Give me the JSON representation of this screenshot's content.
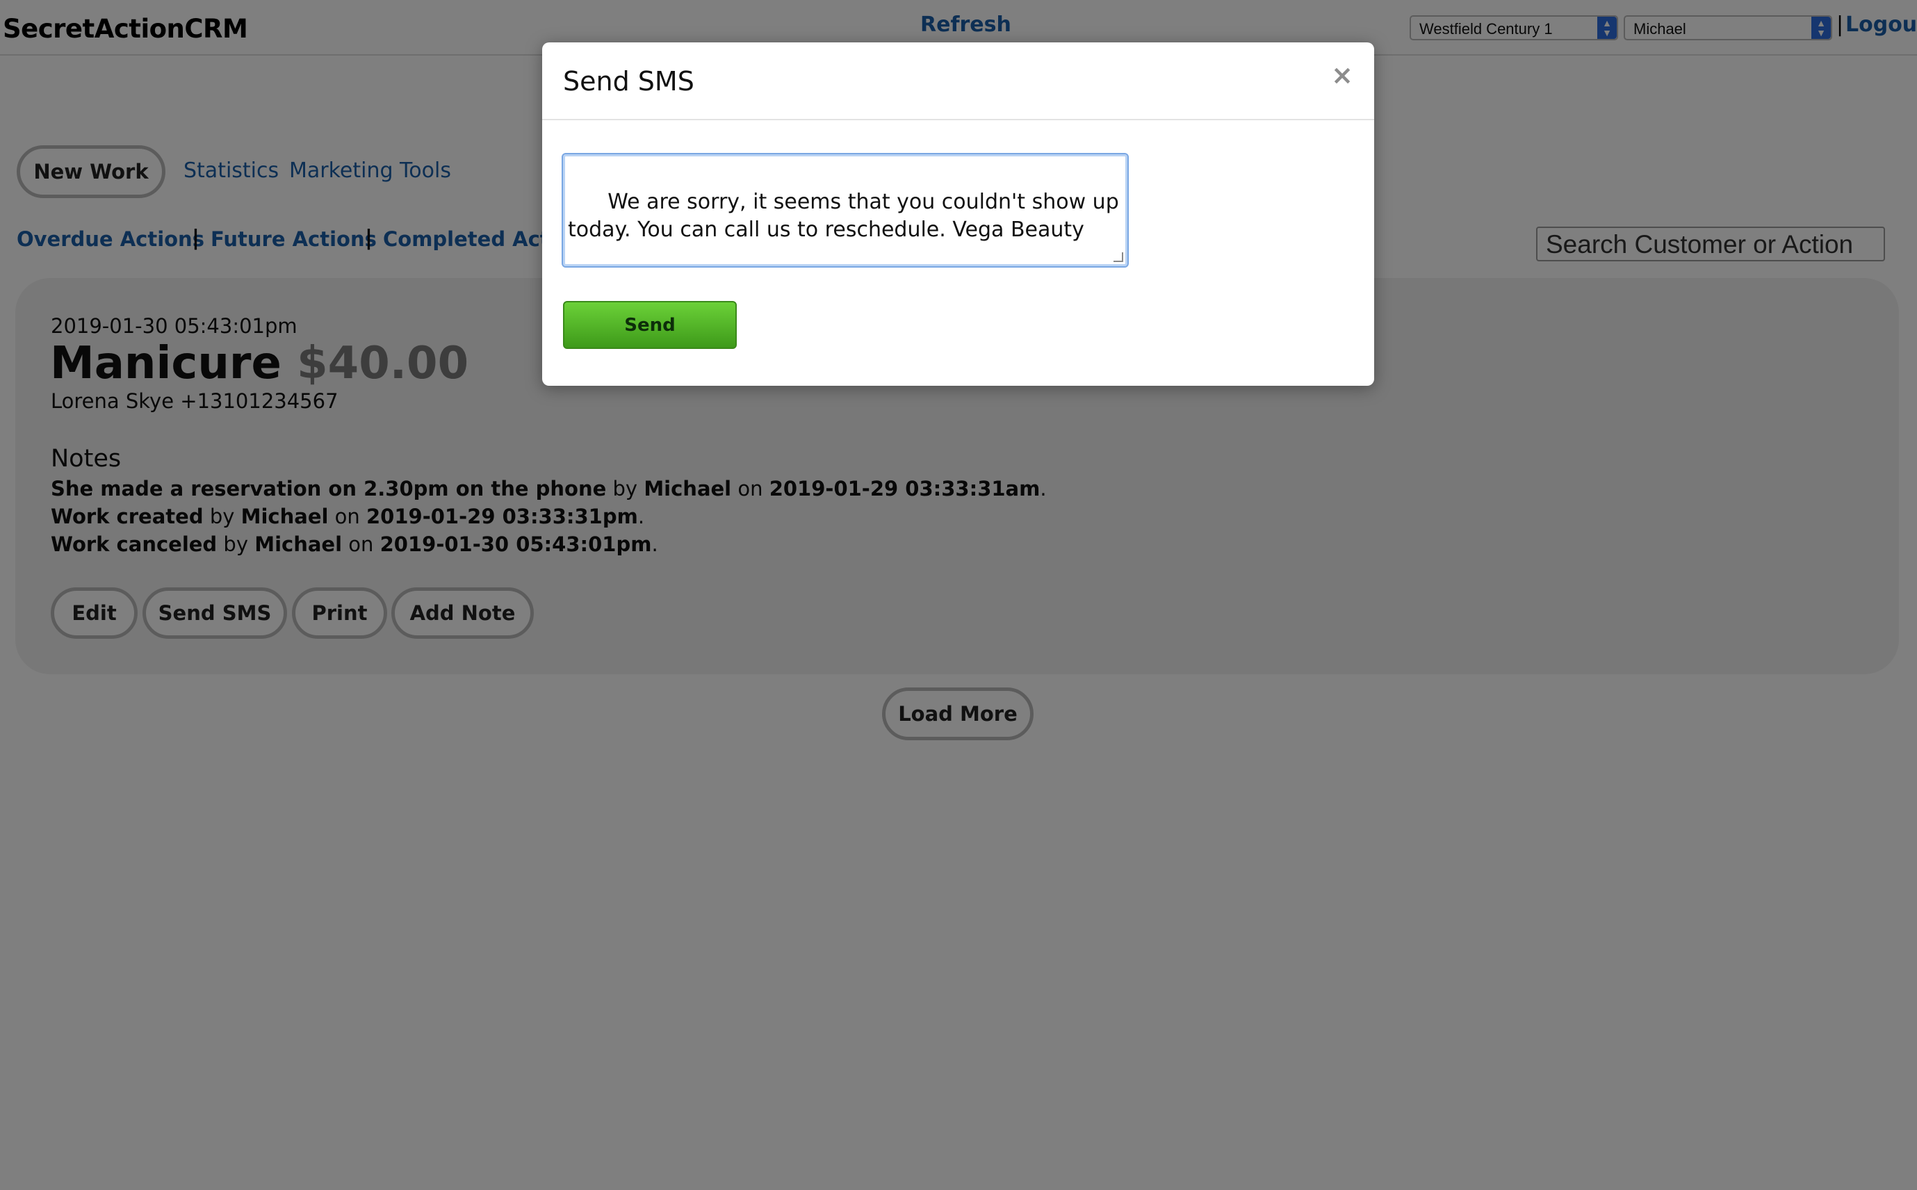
{
  "app": {
    "title": "SecretActionCRM",
    "refresh": "Refresh",
    "logout": "Logout",
    "separator": "|"
  },
  "selectors": {
    "store": "Westfield Century 1",
    "user": "Michael"
  },
  "nav": {
    "new_work": "New Work",
    "statistics": "Statistics",
    "marketing_tools": "Marketing Tools"
  },
  "tabs": {
    "overdue": "Overdue Actions",
    "future": "Future Actions",
    "completed": "Completed Actio",
    "separator": "|"
  },
  "search": {
    "placeholder": "Search Customer or Action"
  },
  "work": {
    "date": "2019-01-30 05:43:01pm",
    "service": "Manicure",
    "price": "$40.00",
    "customer": "Lorena Skye +13101234567",
    "notes_title": "Notes",
    "notes": [
      {
        "text": "She made a reservation on 2.30pm on the phone",
        "by": "by",
        "user": "Michael",
        "on": "on",
        "time": "2019-01-29 03:33:31am",
        "end": "."
      },
      {
        "text": "Work created",
        "by": "by",
        "user": "Michael",
        "on": "on",
        "time": "2019-01-29 03:33:31pm",
        "end": "."
      },
      {
        "text": "Work canceled",
        "by": "by",
        "user": "Michael",
        "on": "on",
        "time": "2019-01-30 05:43:01pm",
        "end": "."
      }
    ],
    "actions": {
      "edit": "Edit",
      "send_sms": "Send SMS",
      "print": "Print",
      "add_note": "Add Note"
    }
  },
  "load_more": "Load More",
  "modal": {
    "title": "Send SMS",
    "close": "×",
    "message": "We are sorry, it seems that you couldn't show up today. You can call us to reschedule. Vega Beauty",
    "send": "Send"
  },
  "icons": {
    "close": "close-icon",
    "select_arrow": "updown-arrow-icon",
    "resize": "resize-handle-icon"
  },
  "colors": {
    "link": "#1b5fa8",
    "send_button": "#4fb526",
    "overlay": "rgba(0,0,0,0.5)"
  }
}
